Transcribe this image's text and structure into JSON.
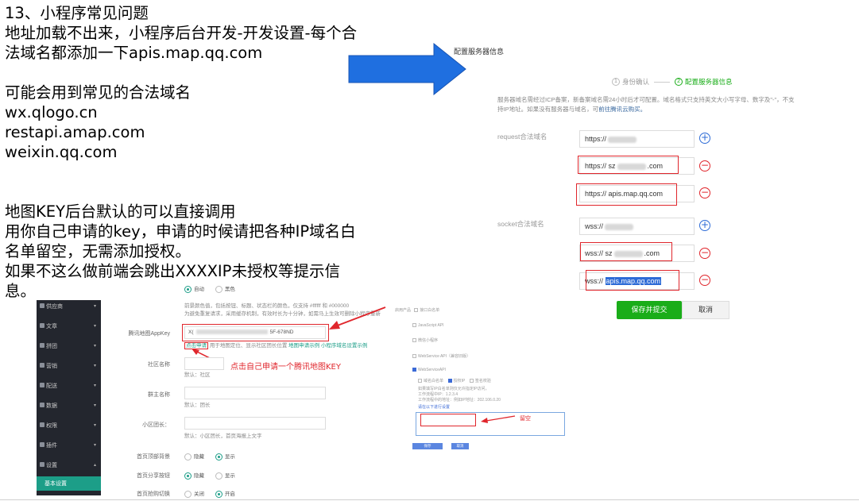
{
  "notes": {
    "l1": "13、小程序常见问题",
    "l2": "地址加载不出来，小程序后台开发-开发设置-每个合",
    "l3": "法域名都添加一下apis.map.qq.com",
    "l4": "可能会用到常见的合法域名",
    "l5": "wx.qlogo.cn",
    "l6": "restapi.amap.com",
    "l7": "weixin.qq.com",
    "l8": "地图KEY后台默认的可以直接调用",
    "l9": "用你自己申请的key，申请的时候请把各种IP域名白",
    "l10": "名单留空，无需添加授权。",
    "l11": "如果不这么做前端会跳出XXXXIP未授权等提示信",
    "l12": "息。"
  },
  "server": {
    "title": "配置服务器信息",
    "step1_num": "1",
    "step1": "身份确认",
    "step2_num": "2",
    "step2": "配置服务器信息",
    "note_a": "服务器域名需经过ICP备案，新备案域名需24小时后才可配置。域名格式只支持英文大小写字母、数字及\"-\"，不支",
    "note_b": "持IP地址。如果没有服务器与域名，可",
    "note_link": "前往腾讯云购买。",
    "request_label": "request合法域名",
    "socket_label": "socket合法域名",
    "req1_prefix": "https://",
    "req2_prefix": "https:// sz",
    "req2_suffix": ".com",
    "req3": "https:// apis.map.qq.com",
    "sock1_prefix": "wss://",
    "sock2_prefix": "wss:// sz",
    "sock2_suffix": ".com",
    "sock3_prefix": "wss:// ",
    "sock3_selected": "apis.map.qq.com",
    "add_symbol": "+",
    "remove_symbol": "−",
    "submit": "保存并提交",
    "cancel": "取消"
  },
  "admin": {
    "sidebar_items": [
      {
        "label": "供应商",
        "caret": "▾"
      },
      {
        "label": "文章",
        "caret": "▾"
      },
      {
        "label": "拼团",
        "caret": "▾"
      },
      {
        "label": "营销",
        "caret": "▾"
      },
      {
        "label": "配送",
        "caret": "▾"
      },
      {
        "label": "数据",
        "caret": "▾"
      },
      {
        "label": "权限",
        "caret": "▾"
      },
      {
        "label": "插件",
        "caret": "▾"
      },
      {
        "label": "设置",
        "caret": "▴"
      }
    ],
    "sidebar_active": "基本设置",
    "top_radio_a": "自动",
    "top_radio_b": "黑色",
    "help1": "前景颜色值，包括按钮、标题、状态栏的颜色，仅支持 #ffffff 和 #000000",
    "help2": "为避免重复请求，采用缓存机制，有效时长为十分钟，如需马上生效可删除小程序重新",
    "key_label": "腾讯地图AppKey",
    "key_prefix": "X(",
    "key_suffix": "5F-678ND",
    "apply_btn": "点击申请",
    "apply_desc": "用于地图定位、显示社区团长位置",
    "apply_links": "地图申请示例 小程序域名设置示例",
    "red_note": "点击自己申请一个腾讯地图KEY",
    "community_label": "社区名称",
    "community_default": "默认：社区",
    "leader_label": "群主名称",
    "leader_default": "默认：团长",
    "small_leader_label": "小区团长：",
    "small_leader_default": "默认：小区团长，首页海报上文字",
    "home_top_label": "首页顶部背景",
    "home_top_a": "隐藏",
    "home_top_b": "显示",
    "home_share_label": "首页分享按钮",
    "home_share_a": "隐藏",
    "home_share_b": "显示",
    "home_switch_label": "首页抢购切换",
    "home_switch_a": "关闭",
    "home_switch_b": "开启"
  },
  "mini": {
    "row1a": "启用产品",
    "row1b": "接口白名单",
    "row2": "JavaScript API",
    "row3": "微信小程序",
    "row4": "WebService API（兼容旧版）",
    "row5": "WebServiceAPI",
    "row6a": "域名白名单",
    "row6b": "授权IP",
    "row6c": "签名校验",
    "help1": "如果填写IP白名单则仅允许指定IP访问，",
    "help2": "工作流程中IP：1.2.3.4",
    "help3": "工作流程中的地址：例如IP地址：202.106.0.20",
    "help4": "请在以下进行设置",
    "leave_blank": "留空",
    "btn_save": "保存",
    "btn_cancel": "取消"
  },
  "colors": {
    "arrow": "#1f6fe0",
    "red": "#e0262c",
    "green": "#1aad19",
    "teal": "#1c9e88",
    "selection": "#2d6bd6"
  }
}
